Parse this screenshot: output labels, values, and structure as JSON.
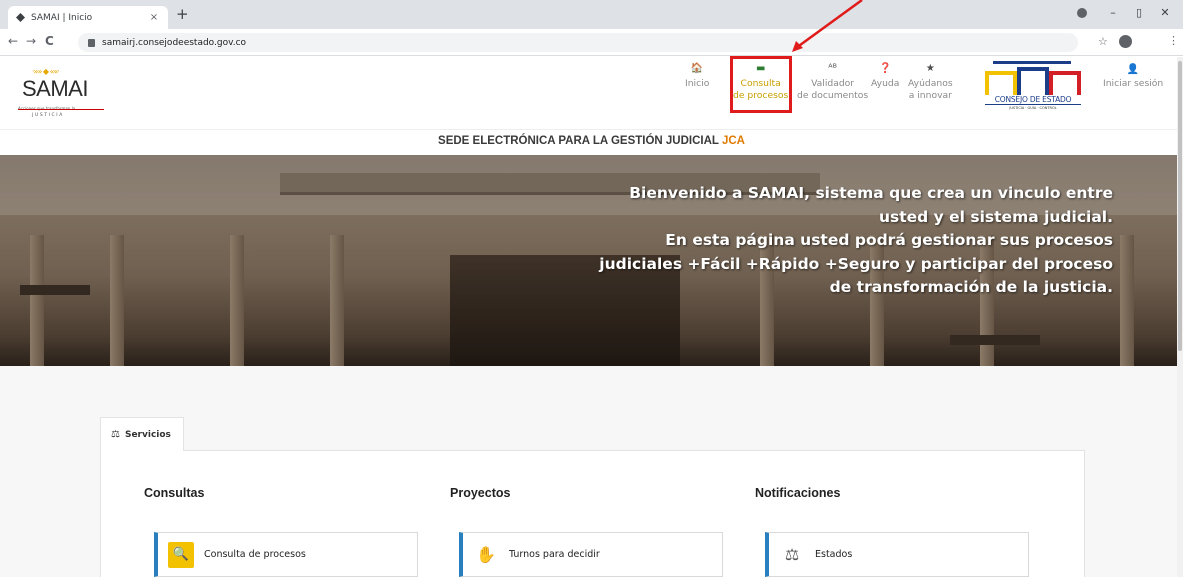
{
  "browser": {
    "tab_title": "SAMAI | Inicio",
    "tab_close": "×",
    "new_tab": "+",
    "url": "samairj.consejodeestado.gov.co",
    "back": "←",
    "forward": "→",
    "reload": "C",
    "minimize": "–",
    "maximize": "▯",
    "close": "✕",
    "bookmark": "☆",
    "menu": "⋮"
  },
  "header": {
    "logo_text": "SAMAI",
    "logo_arrows": "·»» ◆ ««·",
    "logo_slogan": "Acciones que transforman la",
    "logo_sub": "JUSTICIA",
    "nav": [
      {
        "label_1": "Inicio",
        "label_2": "",
        "icon": "🏠"
      },
      {
        "label_1": "Consulta",
        "label_2": "de procesos",
        "icon": "▬"
      },
      {
        "label_1": "Validador",
        "label_2": "de documentos",
        "icon": "ᴬᴮ"
      },
      {
        "label_1": "Ayuda",
        "label_2": "",
        "icon": "❓"
      },
      {
        "label_1": "Ayúdanos",
        "label_2": "a innovar",
        "icon": "★"
      }
    ],
    "ce_name": "CONSEJO DE ESTADO",
    "ce_tag": "JUSTICIA · GUÍA · CONTROL",
    "login_label": "Iniciar sesión",
    "login_icon": "👤"
  },
  "subtitle": {
    "main": "SEDE ELECTRÓNICA PARA LA GESTIÓN JUDICIAL ",
    "highlight": "JCA"
  },
  "hero": {
    "lines": [
      "Bienvenido a SAMAI, sistema que crea un vinculo entre",
      "usted y el sistema judicial.",
      "En esta página usted podrá gestionar sus procesos",
      "judiciales +Fácil +Rápido +Seguro y participar del proceso",
      "de transformación de la justicia."
    ]
  },
  "services": {
    "tab_label": "Servicios",
    "tab_icon": "⚖",
    "columns": [
      {
        "title": "Consultas",
        "card": "Consulta de procesos",
        "icon": "🔍"
      },
      {
        "title": "Proyectos",
        "card": "Turnos para decidir",
        "icon": "✋"
      },
      {
        "title": "Notificaciones",
        "card": "Estados",
        "icon": "⚖"
      }
    ]
  },
  "colors": {
    "accent_orange": "#e07b00",
    "highlight_red": "#e01b1b",
    "card_blue": "#2a7fbf"
  }
}
